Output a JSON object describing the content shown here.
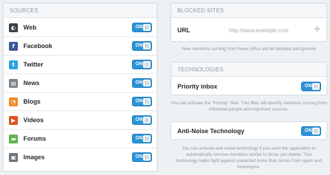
{
  "sources": {
    "header": "SOURCES",
    "items": [
      {
        "label": "Web",
        "icon": "web-icon",
        "icon_glyph": "◐",
        "icon_color": "#3b4248",
        "toggle": "ON"
      },
      {
        "label": "Facebook",
        "icon": "facebook-icon",
        "icon_glyph": "f",
        "icon_color": "#3b5998",
        "toggle": "ON"
      },
      {
        "label": "Twitter",
        "icon": "twitter-icon",
        "icon_glyph": "t",
        "icon_color": "#2aa3e0",
        "toggle": "ON"
      },
      {
        "label": "News",
        "icon": "news-icon",
        "icon_glyph": "▤",
        "icon_color": "#7c8389",
        "toggle": "ON"
      },
      {
        "label": "Blogs",
        "icon": "rss-icon",
        "icon_glyph": "◔",
        "icon_color": "#f08a24",
        "toggle": "ON"
      },
      {
        "label": "Videos",
        "icon": "video-icon",
        "icon_glyph": "▶",
        "icon_color": "#e0531f",
        "toggle": "ON"
      },
      {
        "label": "Forums",
        "icon": "forums-icon",
        "icon_glyph": "▬",
        "icon_color": "#5bb451",
        "toggle": "ON"
      },
      {
        "label": "Images",
        "icon": "images-icon",
        "icon_glyph": "▣",
        "icon_color": "#6d767d",
        "toggle": "ON"
      }
    ]
  },
  "blocked_sites": {
    "header": "BLOCKED SITES",
    "url_label": "URL",
    "url_placeholder": "http://www.example.com",
    "url_value": "",
    "helper": "New mentions coming from these URLs will be blocked and ignored"
  },
  "technologies": {
    "header": "TECHNOLOGIES",
    "priority_label": "Priority inbox",
    "priority_toggle": "ON",
    "priority_helper": "You can activate the \"Priority\" filter. This filter will identify mentions coming from influential people and important sources.",
    "antinoise_label": "Anti-Noise Technology",
    "antinoise_toggle": "ON",
    "antinoise_helper": "You can activate anti-noise technology if you want the application to automatically remove mentions similar to those you delete. This technology helps fight against unwanted noise that comes from spam and homonyms."
  },
  "colors": {
    "toggle_on": "#2b93d8",
    "panel_bg": "#ffffff",
    "page_bg": "#eef1f3",
    "header_text": "#8b97a1"
  }
}
